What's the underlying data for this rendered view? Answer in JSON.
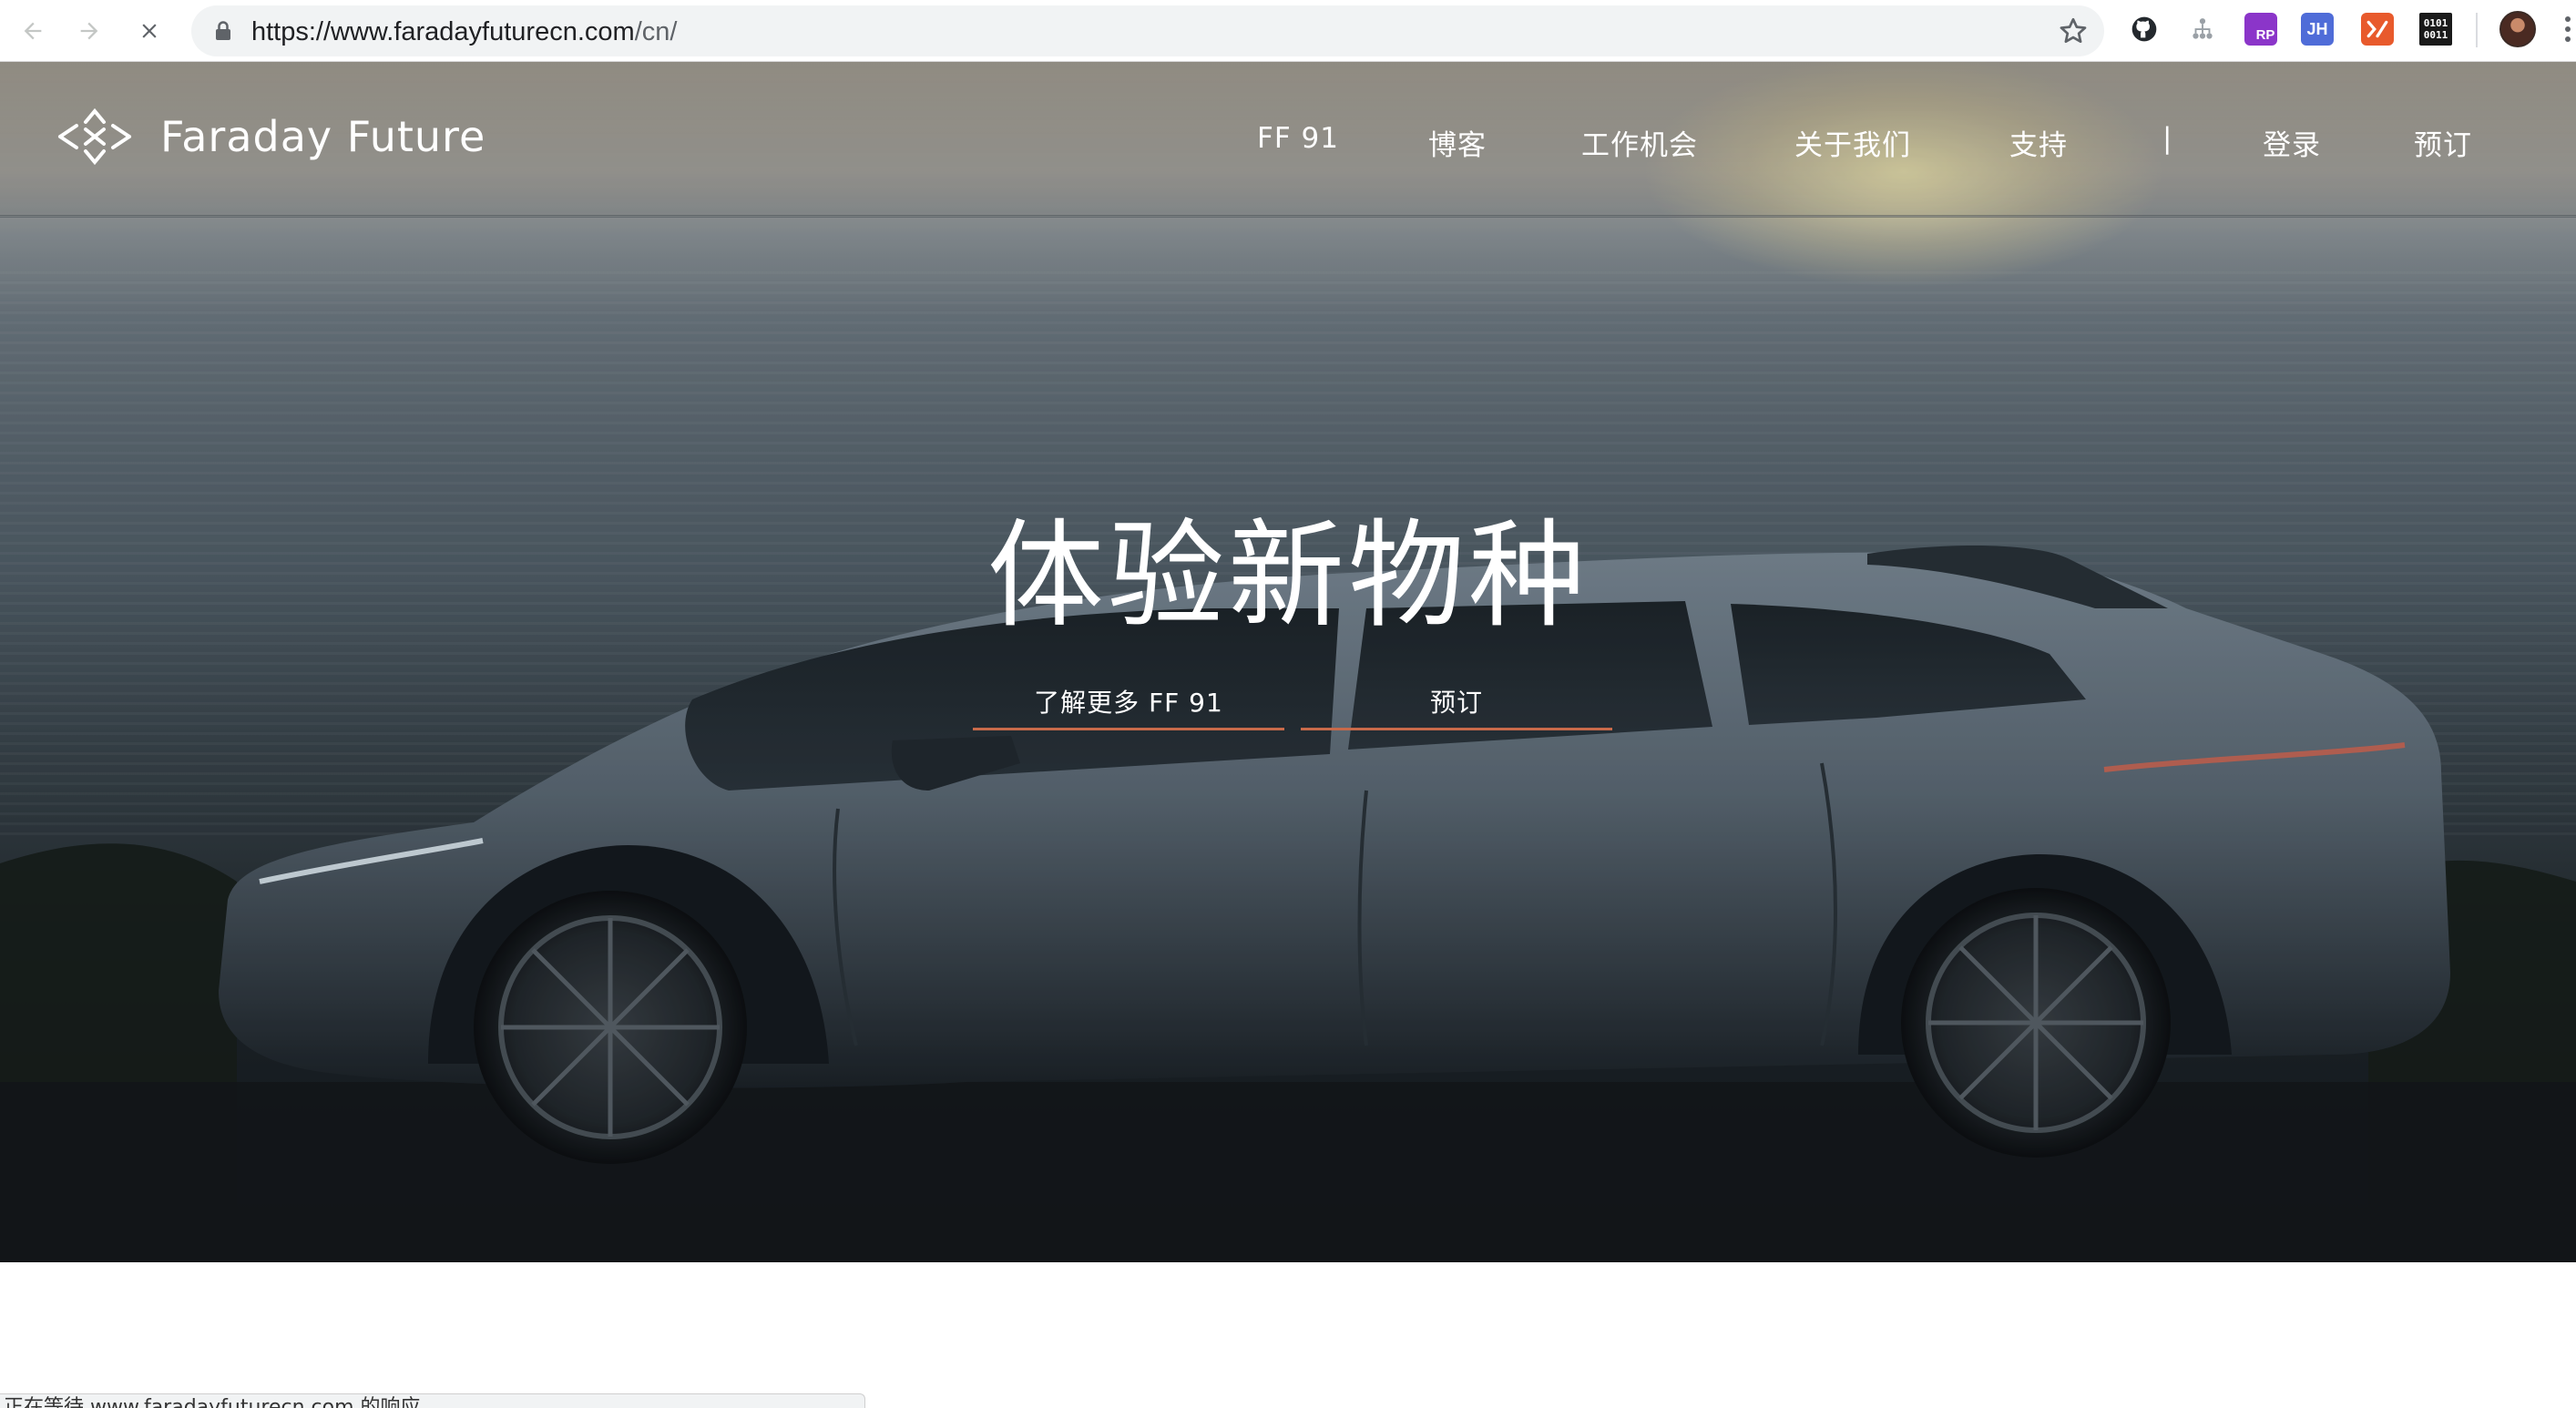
{
  "browser": {
    "url_domain": "https://www.faradayfuturecn.com",
    "url_path": "/cn/",
    "extensions": [
      {
        "name": "github-extension",
        "label": "",
        "color": "#24292e"
      },
      {
        "name": "tree-extension",
        "label": "",
        "color": "#9aa0a6"
      },
      {
        "name": "rp-extension",
        "label": "RP",
        "color": "#8b35c9"
      },
      {
        "name": "jh-extension",
        "label": "JH",
        "color": "#4f6cd8"
      },
      {
        "name": "translate-extension",
        "label": "",
        "color": "#e85a2c"
      },
      {
        "name": "binary-extension",
        "label": "0101 0011",
        "color": "#1a1a1a"
      }
    ]
  },
  "site": {
    "brand": "Faraday Future",
    "nav": [
      "FF 91",
      "博客",
      "工作机会",
      "关于我们",
      "支持",
      "|",
      "登录",
      "预订"
    ],
    "headline": "体验新物种",
    "cta_learn_more": "了解更多 FF 91",
    "cta_reserve": "预订"
  },
  "status_text": "正在等待 www.faradayfuturecn.com 的响应...",
  "colors": {
    "cta_underline": "#c86a4a",
    "omnibox_bg": "#f1f3f4"
  }
}
